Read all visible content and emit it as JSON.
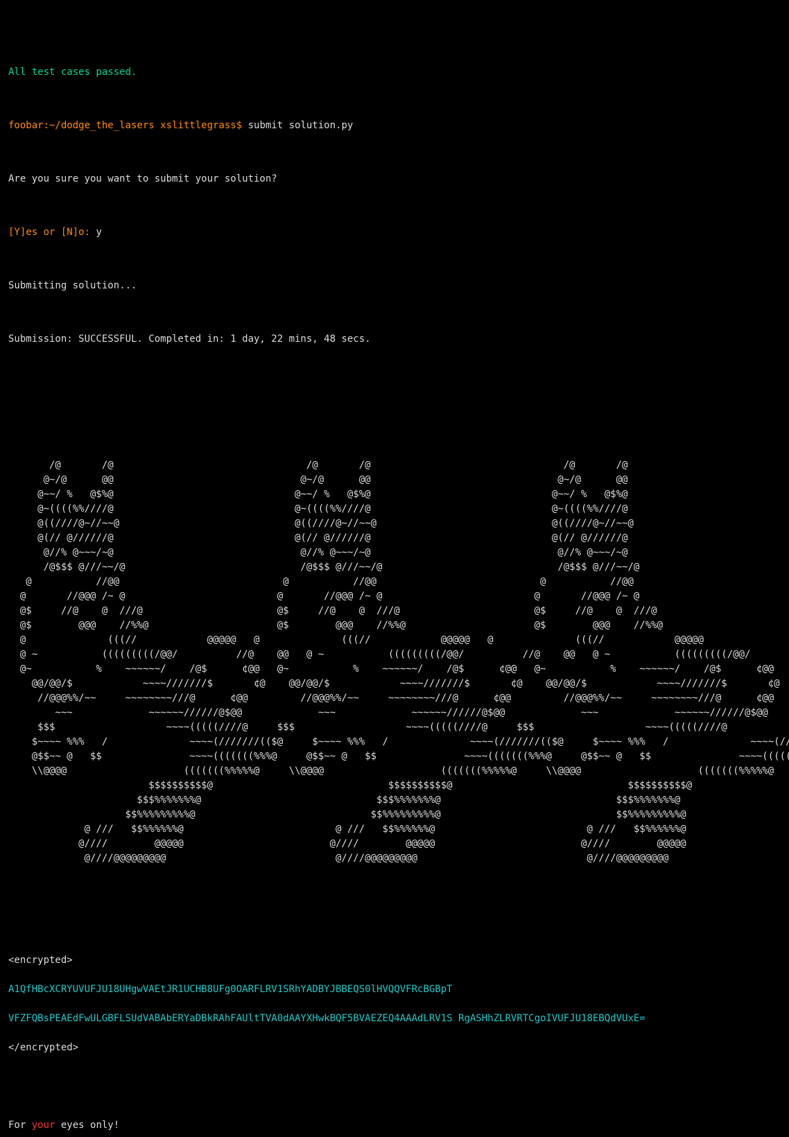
{
  "colors": {
    "green": "#00d68f",
    "orange": "#ff8c00",
    "cyan": "#1ec8c8",
    "red": "#ff3333",
    "bg": "#000000",
    "fg": "#dddddd"
  },
  "result_line": "All test cases passed.",
  "prompt": {
    "host_path": "foobar:~/dodge_the_lasers xslittlegrass$",
    "command": " submit solution.py"
  },
  "confirm_question": "Are you sure you want to submit your solution?",
  "confirm_prompt": "[Y]es or [N]o:",
  "confirm_answer": " y",
  "submitting": "Submitting solution...",
  "submission_status": "Submission: SUCCESSFUL. Completed in: 1 day, 22 mins, 48 secs.",
  "ascii_art": [
    "       /@       /@                                 /@       /@                                 /@       /@",
    "      @~/@      @@                                @~/@      @@                                @~/@      @@",
    "     @~~/ %   @$%@                               @~~/ %   @$%@                               @~~/ %   @$%@",
    "     @~((((%%////@                               @~((((%%////@                               @~((((%%////@",
    "     @((////@~//~~@                              @((////@~//~~@                              @((////@~//~~@",
    "     @(// @//////@                               @(// @//////@                               @(// @//////@",
    "      @//% @~~~/~@                                @//% @~~~/~@                                @//% @~~~/~@",
    "      /@$$$ @///~~/@                              /@$$$ @///~~/@                              /@$$$ @///~~/@",
    "   @           //@@                            @           //@@                            @           //@@",
    "  @       //@@@ /~ @                          @       //@@@ /~ @                          @       //@@@ /~ @",
    "  @$     //@    @  ///@                       @$     //@    @  ///@                       @$     //@    @  ///@",
    "  @$        @@@    //%%@                      @$        @@@    //%%@                      @$        @@@    //%%@",
    "  @              (((//            @@@@@   @              (((//            @@@@@   @              (((//            @@@@@",
    "  @ ~           (((((((((/@@/          //@    @@   @ ~           (((((((((/@@/          //@    @@   @ ~           (((((((((/@@/          //@    @@",
    "  @~           %    ~~~~~~/    /@$      ¢@@   @~           %    ~~~~~~/    /@$      ¢@@   @~           %    ~~~~~~/    /@$      ¢@@",
    "    @@/@@/$            ~~~~///////$       ¢@    @@/@@/$            ~~~~///////$       ¢@    @@/@@/$            ~~~~///////$       ¢@",
    "     //@@@%%/~~     ~~~~~~~~///@      ¢@@         //@@@%%/~~     ~~~~~~~~///@      ¢@@         //@@@%%/~~     ~~~~~~~~///@      ¢@@",
    "        ~~~             ~~~~~~//////@$@@             ~~~             ~~~~~~//////@$@@             ~~~             ~~~~~~//////@$@@",
    "     $$$                   ~~~~(((((////@     $$$                   ~~~~(((((////@     $$$                   ~~~~(((((////@",
    "    $~~~~ %%%   /              ~~~~(///////(($@     $~~~~ %%%   /              ~~~~(///////(($@     $~~~~ %%%   /              ~~~~(///////(($@",
    "    @$$~~ @   $$               ~~~~(((((((%%%@     @$$~~ @   $$               ~~~~(((((((%%%@     @$$~~ @   $$               ~~~~(((((((%%%@",
    "    \\\\@@@@                    (((((((%%%%%@     \\\\@@@@                    (((((((%%%%%@     \\\\@@@@                    (((((((%%%%%@",
    "                        $$$$$$$$$$@                              $$$$$$$$$$@                              $$$$$$$$$$@",
    "                      $$$%%%%%%%@                              $$$%%%%%%%@                              $$$%%%%%%%@",
    "                    $$%%%%%%%%%@                              $$%%%%%%%%%@                              $$%%%%%%%%%@",
    "             @ ///   $$%%%%%%@                          @ ///   $$%%%%%%@                          @ ///   $$%%%%%%@",
    "            @////        @@@@@                         @////        @@@@@                         @////        @@@@@",
    "             @////@@@@@@@@@                             @////@@@@@@@@@                             @////@@@@@@@@@"
  ],
  "encrypted": {
    "open_tag": "<encrypted>",
    "line1": "A1QfHBcXCRYUVUFJU18UHgwVAEtJR1UCHB8UFg0OARFLRV1SRhYADBYJBBEQS0lHVQQVFRcBGBpT",
    "line2": "VFZFQBsPEAEdFwULGBFLSUdVABAbERYaDBkRAhFAUltTVA0dAAYXHwkBQF5BVAEZEQ4AAAdLRV1S RgASHhZLRVRTCgoIVUFJU18EBQdVUxE=",
    "close_tag": "</encrypted>"
  },
  "footer": {
    "prefix": "For ",
    "highlight": "your",
    "suffix": " eyes only!"
  }
}
